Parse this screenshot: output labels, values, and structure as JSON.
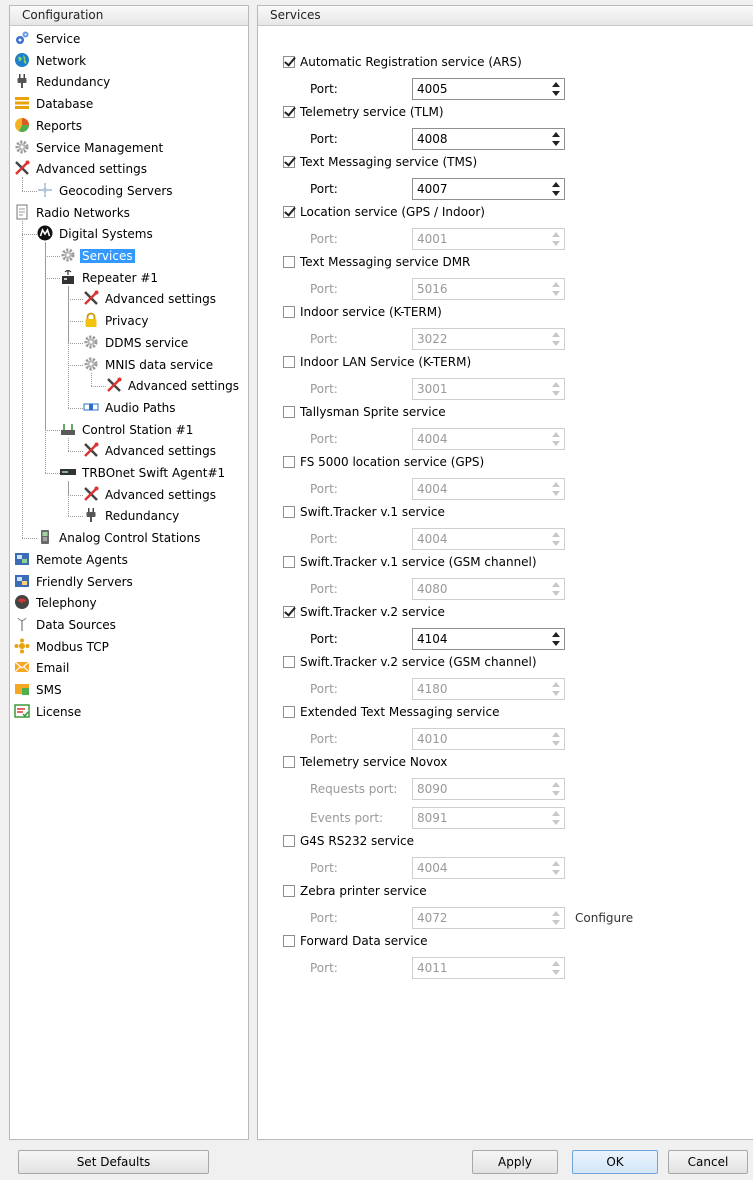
{
  "left_panel": {
    "title": "Configuration"
  },
  "right_panel": {
    "title": "Services"
  },
  "tree": [
    {
      "label": "Service",
      "icon": "gears-icon",
      "level": 0
    },
    {
      "label": "Network",
      "icon": "globe-icon",
      "level": 0
    },
    {
      "label": "Redundancy",
      "icon": "plug-icon",
      "level": 0
    },
    {
      "label": "Database",
      "icon": "database-icon",
      "level": 0
    },
    {
      "label": "Reports",
      "icon": "reports-icon",
      "level": 0
    },
    {
      "label": "Service Management",
      "icon": "gear-icon",
      "level": 0
    },
    {
      "label": "Advanced settings",
      "icon": "tools-icon",
      "level": 0
    },
    {
      "label": "Geocoding Servers",
      "icon": "compass-icon",
      "level": 1
    },
    {
      "label": "Radio Networks",
      "icon": "document-icon",
      "level": 0
    },
    {
      "label": "Digital Systems",
      "icon": "motorola-icon",
      "level": 1
    },
    {
      "label": "Services",
      "icon": "gear-icon",
      "level": 2,
      "selected": true
    },
    {
      "label": "Repeater #1",
      "icon": "repeater-icon",
      "level": 2
    },
    {
      "label": "Advanced settings",
      "icon": "tools-icon",
      "level": 3
    },
    {
      "label": "Privacy",
      "icon": "lock-icon",
      "level": 3
    },
    {
      "label": "DDMS service",
      "icon": "gear-icon",
      "level": 3
    },
    {
      "label": "MNIS data service",
      "icon": "gear-icon",
      "level": 3
    },
    {
      "label": "Advanced settings",
      "icon": "tools-icon",
      "level": 4
    },
    {
      "label": "Audio Paths",
      "icon": "audio-paths-icon",
      "level": 3
    },
    {
      "label": "Control Station #1",
      "icon": "control-station-icon",
      "level": 2
    },
    {
      "label": "Advanced settings",
      "icon": "tools-icon",
      "level": 3
    },
    {
      "label": "TRBOnet Swift Agent#1",
      "icon": "agent-device-icon",
      "level": 2
    },
    {
      "label": "Advanced settings",
      "icon": "tools-icon",
      "level": 3
    },
    {
      "label": "Redundancy",
      "icon": "plug-icon",
      "level": 3
    },
    {
      "label": "Analog Control Stations",
      "icon": "handset-icon",
      "level": 1
    },
    {
      "label": "Remote Agents",
      "icon": "remote-agents-icon",
      "level": 0
    },
    {
      "label": "Friendly Servers",
      "icon": "friendly-servers-icon",
      "level": 0
    },
    {
      "label": "Telephony",
      "icon": "phone-icon",
      "level": 0
    },
    {
      "label": "Data Sources",
      "icon": "antenna-icon",
      "level": 0
    },
    {
      "label": "Modbus TCP",
      "icon": "modbus-icon",
      "level": 0
    },
    {
      "label": "Email",
      "icon": "email-icon",
      "level": 0
    },
    {
      "label": "SMS",
      "icon": "sms-icon",
      "level": 0
    },
    {
      "label": "License",
      "icon": "license-icon",
      "level": 0
    }
  ],
  "services": [
    {
      "label": "Automatic Registration service (ARS)",
      "checked": true,
      "ports": [
        {
          "label": "Port:",
          "value": "4005"
        }
      ]
    },
    {
      "label": "Telemetry service (TLM)",
      "checked": true,
      "ports": [
        {
          "label": "Port:",
          "value": "4008"
        }
      ]
    },
    {
      "label": "Text Messaging service (TMS)",
      "checked": true,
      "ports": [
        {
          "label": "Port:",
          "value": "4007"
        }
      ]
    },
    {
      "label": "Location service (GPS / Indoor)",
      "checked": true,
      "disabled": true,
      "ports": [
        {
          "label": "Port:",
          "value": "4001"
        }
      ]
    },
    {
      "label": "Text Messaging service DMR",
      "checked": false,
      "ports": [
        {
          "label": "Port:",
          "value": "5016"
        }
      ]
    },
    {
      "label": "Indoor service (K-TERM)",
      "checked": false,
      "ports": [
        {
          "label": "Port:",
          "value": "3022"
        }
      ]
    },
    {
      "label": "Indoor LAN Service (K-TERM)",
      "checked": false,
      "ports": [
        {
          "label": "Port:",
          "value": "3001"
        }
      ]
    },
    {
      "label": "Tallysman Sprite service",
      "checked": false,
      "ports": [
        {
          "label": "Port:",
          "value": "4004"
        }
      ]
    },
    {
      "label": "FS 5000 location service (GPS)",
      "checked": false,
      "ports": [
        {
          "label": "Port:",
          "value": "4004"
        }
      ]
    },
    {
      "label": "Swift.Tracker v.1 service",
      "checked": false,
      "ports": [
        {
          "label": "Port:",
          "value": "4004"
        }
      ]
    },
    {
      "label": "Swift.Tracker v.1 service (GSM channel)",
      "checked": false,
      "ports": [
        {
          "label": "Port:",
          "value": "4080"
        }
      ]
    },
    {
      "label": "Swift.Tracker v.2 service",
      "checked": true,
      "ports": [
        {
          "label": "Port:",
          "value": "4104"
        }
      ]
    },
    {
      "label": "Swift.Tracker v.2 service (GSM channel)",
      "checked": false,
      "ports": [
        {
          "label": "Port:",
          "value": "4180"
        }
      ]
    },
    {
      "label": "Extended Text Messaging service",
      "checked": false,
      "ports": [
        {
          "label": "Port:",
          "value": "4010"
        }
      ]
    },
    {
      "label": "Telemetry service Novox",
      "checked": false,
      "ports": [
        {
          "label": "Requests port:",
          "value": "8090"
        },
        {
          "label": "Events port:",
          "value": "8091"
        }
      ]
    },
    {
      "label": "G4S RS232 service",
      "checked": false,
      "ports": [
        {
          "label": "Port:",
          "value": "4004"
        }
      ]
    },
    {
      "label": "Zebra printer service",
      "checked": false,
      "ports": [
        {
          "label": "Port:",
          "value": "4072"
        }
      ],
      "extra": "Configure"
    },
    {
      "label": "Forward Data service",
      "checked": false,
      "ports": [
        {
          "label": "Port:",
          "value": "4011"
        }
      ]
    }
  ],
  "buttons": {
    "set_defaults": "Set Defaults",
    "apply": "Apply",
    "ok": "OK",
    "cancel": "Cancel"
  }
}
